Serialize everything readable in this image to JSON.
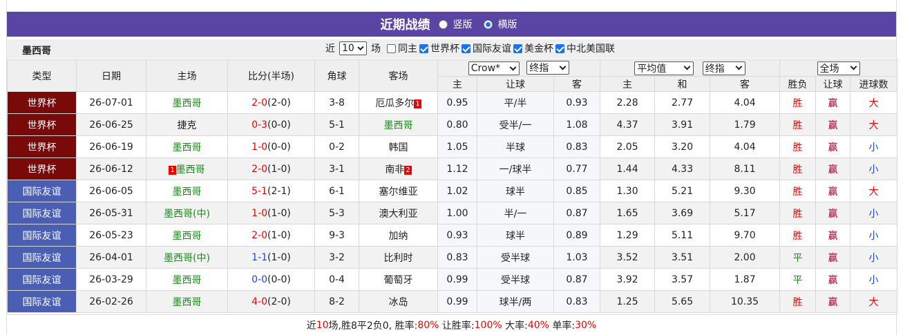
{
  "header": {
    "title": "近期战绩",
    "layout_options": [
      {
        "label": "竖版",
        "selected": false
      },
      {
        "label": "横版",
        "selected": true
      }
    ]
  },
  "filters": {
    "team": "墨西哥",
    "recent_prefix": "近",
    "recent_value": "10",
    "recent_suffix": "场",
    "same_home": {
      "label": "同主",
      "checked": false
    },
    "competitions": [
      {
        "label": "世界杯",
        "checked": true
      },
      {
        "label": "国际友谊",
        "checked": true
      },
      {
        "label": "美金杯",
        "checked": true
      },
      {
        "label": "中北美国联",
        "checked": true
      }
    ]
  },
  "columns": {
    "type": "类型",
    "date": "日期",
    "home": "主场",
    "score": "比分(半场)",
    "corner": "角球",
    "away": "客场",
    "bookmaker_select": "Crow*",
    "odds_type_select": "终指",
    "avg_select": "平均值",
    "avg_type_select": "终指",
    "scope_select": "全场",
    "sub": {
      "home": "主",
      "handicap": "让球",
      "away": "客",
      "avg_home": "主",
      "avg_draw": "和",
      "avg_away": "客",
      "result": "胜负",
      "handicap_result": "让球",
      "goals": "进球数"
    }
  },
  "matches": [
    {
      "type": "世界杯",
      "type_class": "wc",
      "date": "26-07-01",
      "home": "墨西哥",
      "home_badge": "",
      "home_is_team": true,
      "score": "2-0",
      "half": "(2-0)",
      "score_color": "red",
      "corner": "3-8",
      "away": "厄瓜多尔",
      "away_badge": "1",
      "away_is_team": false,
      "o_home": "0.95",
      "handicap": "平/半",
      "o_away": "0.93",
      "a_home": "2.28",
      "a_draw": "2.77",
      "a_away": "4.04",
      "result": "胜",
      "hresult": "赢",
      "goals": "大"
    },
    {
      "type": "世界杯",
      "type_class": "wc",
      "date": "26-06-25",
      "home": "捷克",
      "home_badge": "",
      "home_is_team": false,
      "score": "0-3",
      "half": "(0-0)",
      "score_color": "red",
      "corner": "5-1",
      "away": "墨西哥",
      "away_badge": "",
      "away_is_team": true,
      "o_home": "0.80",
      "handicap": "受半/一",
      "o_away": "1.08",
      "a_home": "4.37",
      "a_draw": "3.91",
      "a_away": "1.79",
      "result": "胜",
      "hresult": "赢",
      "goals": "大"
    },
    {
      "type": "世界杯",
      "type_class": "wc",
      "date": "26-06-19",
      "home": "墨西哥",
      "home_badge": "",
      "home_is_team": true,
      "score": "1-0",
      "half": "(0-0)",
      "score_color": "red",
      "corner": "0-2",
      "away": "韩国",
      "away_badge": "",
      "away_is_team": false,
      "o_home": "1.05",
      "handicap": "半球",
      "o_away": "0.83",
      "a_home": "2.05",
      "a_draw": "3.20",
      "a_away": "4.04",
      "result": "胜",
      "hresult": "赢",
      "goals": "小"
    },
    {
      "type": "世界杯",
      "type_class": "wc",
      "date": "26-06-12",
      "home": "墨西哥",
      "home_badge": "1",
      "home_is_team": true,
      "score": "2-0",
      "half": "(1-0)",
      "score_color": "red",
      "corner": "3-1",
      "away": "南非",
      "away_badge": "2",
      "away_is_team": false,
      "o_home": "1.12",
      "handicap": "一/球半",
      "o_away": "0.77",
      "a_home": "1.44",
      "a_draw": "4.33",
      "a_away": "8.11",
      "result": "胜",
      "hresult": "赢",
      "goals": "小"
    },
    {
      "type": "国际友谊",
      "type_class": "fr",
      "date": "26-06-05",
      "home": "墨西哥",
      "home_badge": "",
      "home_is_team": true,
      "score": "5-1",
      "half": "(2-1)",
      "score_color": "red",
      "corner": "6-1",
      "away": "塞尔维亚",
      "away_badge": "",
      "away_is_team": false,
      "o_home": "1.02",
      "handicap": "球半",
      "o_away": "0.85",
      "a_home": "1.30",
      "a_draw": "5.21",
      "a_away": "9.30",
      "result": "胜",
      "hresult": "赢",
      "goals": "大"
    },
    {
      "type": "国际友谊",
      "type_class": "fr",
      "date": "26-05-31",
      "home": "墨西哥(中)",
      "home_badge": "",
      "home_is_team": true,
      "score": "1-0",
      "half": "(1-0)",
      "score_color": "red",
      "corner": "5-3",
      "away": "澳大利亚",
      "away_badge": "",
      "away_is_team": false,
      "o_home": "1.00",
      "handicap": "半/一",
      "o_away": "0.87",
      "a_home": "1.65",
      "a_draw": "3.69",
      "a_away": "5.17",
      "result": "胜",
      "hresult": "赢",
      "goals": "小"
    },
    {
      "type": "国际友谊",
      "type_class": "fr",
      "date": "26-05-23",
      "home": "墨西哥",
      "home_badge": "",
      "home_is_team": true,
      "score": "2-0",
      "half": "(1-0)",
      "score_color": "red",
      "corner": "9-3",
      "away": "加纳",
      "away_badge": "",
      "away_is_team": false,
      "o_home": "0.93",
      "handicap": "球半",
      "o_away": "0.89",
      "a_home": "1.29",
      "a_draw": "5.11",
      "a_away": "9.70",
      "result": "胜",
      "hresult": "赢",
      "goals": "小"
    },
    {
      "type": "国际友谊",
      "type_class": "fr",
      "date": "26-04-01",
      "home": "墨西哥(中)",
      "home_badge": "",
      "home_is_team": true,
      "score": "1-1",
      "half": "(1-0)",
      "score_color": "blue",
      "corner": "3-2",
      "away": "比利时",
      "away_badge": "",
      "away_is_team": false,
      "o_home": "0.83",
      "handicap": "受半球",
      "o_away": "1.03",
      "a_home": "3.52",
      "a_draw": "3.51",
      "a_away": "2.00",
      "result": "平",
      "hresult": "赢",
      "goals": "小"
    },
    {
      "type": "国际友谊",
      "type_class": "fr",
      "date": "26-03-29",
      "home": "墨西哥",
      "home_badge": "",
      "home_is_team": true,
      "score": "0-0",
      "half": "(0-0)",
      "score_color": "blue",
      "corner": "0-4",
      "away": "葡萄牙",
      "away_badge": "",
      "away_is_team": false,
      "o_home": "0.99",
      "handicap": "受半球",
      "o_away": "0.87",
      "a_home": "3.92",
      "a_draw": "3.57",
      "a_away": "1.87",
      "result": "平",
      "hresult": "赢",
      "goals": "小"
    },
    {
      "type": "国际友谊",
      "type_class": "fr",
      "date": "26-02-26",
      "home": "墨西哥",
      "home_badge": "",
      "home_is_team": true,
      "score": "4-0",
      "half": "(2-0)",
      "score_color": "red",
      "corner": "8-2",
      "away": "冰岛",
      "away_badge": "",
      "away_is_team": false,
      "o_home": "0.99",
      "handicap": "球半/两",
      "o_away": "0.83",
      "a_home": "1.25",
      "a_draw": "5.65",
      "a_away": "10.35",
      "result": "胜",
      "hresult": "赢",
      "goals": "大"
    }
  ],
  "summary": {
    "t1": "近",
    "count": "10",
    "t2": "场,胜8平2负0, 胜率:",
    "win_rate": "80%",
    "t3": " 让胜率:",
    "handicap_rate": "100%",
    "t4": " 大率:",
    "big_rate": "40%",
    "t5": " 单率:",
    "odd_rate": "30%"
  },
  "colors": {
    "title_bg": "#5a44a4",
    "world_cup": "#7a0a0a",
    "friendly": "#4a5fb4",
    "win_red": "#e00000",
    "team_green": "#1a8a1a"
  }
}
